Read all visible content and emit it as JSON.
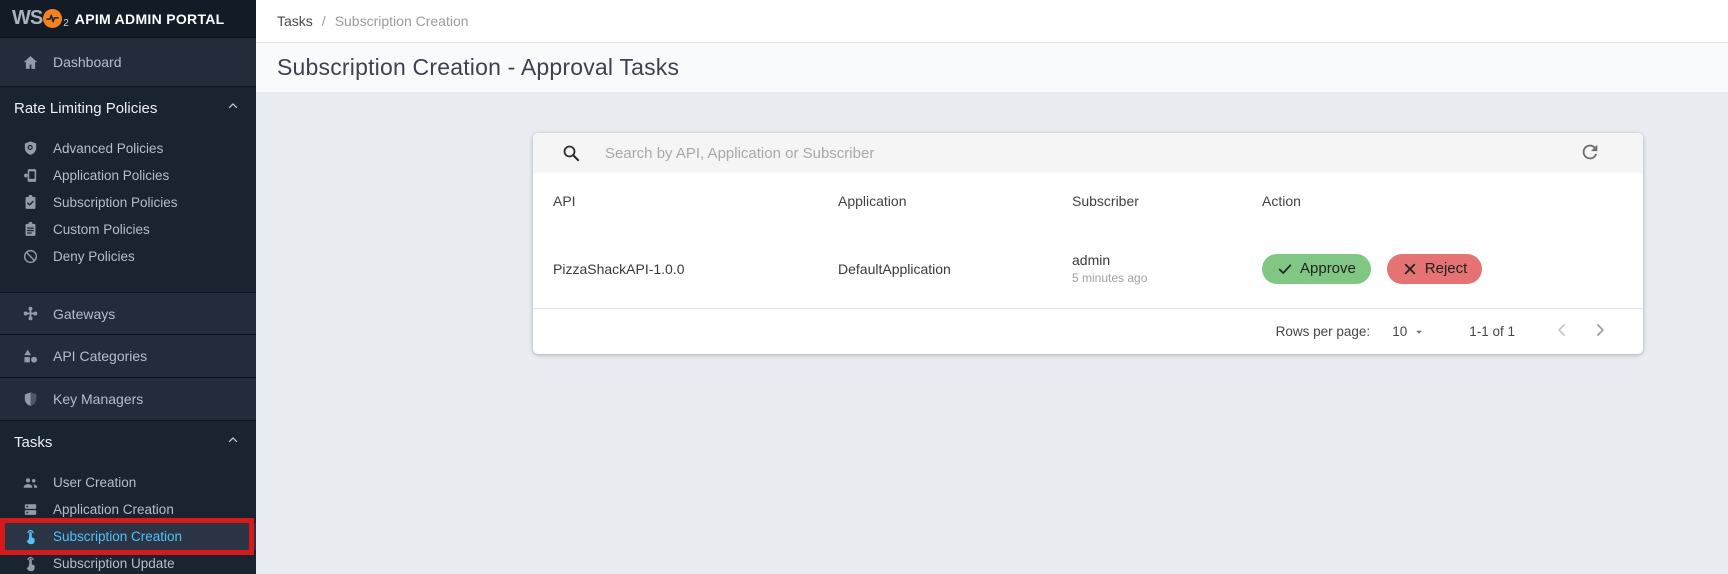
{
  "app": {
    "logo_ws": "WS",
    "logo_sub": "2",
    "logo_title": "APIM ADMIN PORTAL"
  },
  "sidebar": {
    "dashboard_label": "Dashboard",
    "rate_limiting": {
      "header": "Rate Limiting Policies",
      "items": [
        {
          "label": "Advanced Policies"
        },
        {
          "label": "Application Policies"
        },
        {
          "label": "Subscription Policies"
        },
        {
          "label": "Custom Policies"
        },
        {
          "label": "Deny Policies"
        }
      ]
    },
    "standalone_items": [
      {
        "label": "Gateways"
      },
      {
        "label": "API Categories"
      },
      {
        "label": "Key Managers"
      }
    ],
    "tasks": {
      "header": "Tasks",
      "items": [
        {
          "label": "User Creation"
        },
        {
          "label": "Application Creation"
        },
        {
          "label": "Subscription Creation",
          "selected": true
        },
        {
          "label": "Subscription Update"
        }
      ]
    }
  },
  "breadcrumb": {
    "parent": "Tasks",
    "separator": "/",
    "current": "Subscription Creation"
  },
  "page": {
    "title": "Subscription Creation - Approval Tasks"
  },
  "panel": {
    "search_placeholder": "Search by API, Application or Subscriber",
    "table": {
      "headers": [
        "API",
        "Application",
        "Subscriber",
        "Action"
      ],
      "rows": [
        {
          "api": "PizzaShackAPI-1.0.0",
          "application": "DefaultApplication",
          "subscriber": "admin",
          "subscriber_time": "5 minutes ago",
          "approve_label": "Approve",
          "reject_label": "Reject"
        }
      ]
    },
    "pagination": {
      "rows_per_page_label": "Rows per page:",
      "rows_per_page_value": "10",
      "range_label": "1-1 of 1"
    }
  },
  "icons": {
    "logo-pulse-icon": "heartbeat line in orange circle",
    "home-icon": "house",
    "shield-search-icon": "shield with lens",
    "mobile-policy-icon": "device with gear",
    "clipboard-check-icon": "clipboard with check",
    "clipboard-lines-icon": "clipboard with lines",
    "deny-icon": "circle with slash",
    "gateway-icon": "plus of nodes",
    "categories-icon": "triangle square circle",
    "shield-half-icon": "half shield",
    "users-icon": "two people",
    "stack-icon": "stacked servers",
    "touch-icon": "pointing hand",
    "chevron-up-icon": "collapse caret",
    "search-icon": "magnifier",
    "refresh-icon": "circular arrow",
    "caret-down-icon": "dropdown triangle",
    "chevron-left-icon": "previous page",
    "chevron-right-icon": "next page",
    "check-icon": "checkmark",
    "x-icon": "cross"
  },
  "colors": {
    "sidebar_bg": "#1a2330",
    "logo_orange": "#f5821f",
    "selected_blue": "#4fc3f7",
    "annotation_red": "#d8191c",
    "approve_green": "#81c784",
    "reject_red": "#e57373",
    "content_bg": "#e9edf1"
  }
}
